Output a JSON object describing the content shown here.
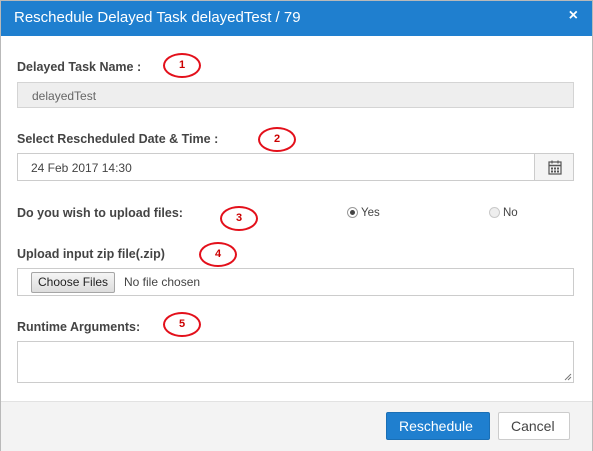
{
  "dialog": {
    "title": "Reschedule Delayed Task delayedTest / 79",
    "close_glyph": "×"
  },
  "task_name": {
    "label": "Delayed Task Name :",
    "value": "delayedTest"
  },
  "reschedule_date": {
    "label": "Select Rescheduled Date & Time :",
    "value": "24 Feb 2017 14:30",
    "button_icon": "calendar-icon"
  },
  "upload_choice": {
    "label": "Do you wish to upload files:",
    "options": [
      {
        "label": "Yes",
        "selected": true
      },
      {
        "label": "No",
        "selected": false
      }
    ]
  },
  "upload_zip": {
    "label": "Upload input zip file(.zip)",
    "button_label": "Choose Files",
    "status": "No file chosen"
  },
  "runtime_args": {
    "label": "Runtime Arguments:",
    "value": ""
  },
  "footer": {
    "primary_label": "Reschedule",
    "cancel_label": "Cancel"
  },
  "annotations": [
    "1",
    "2",
    "3",
    "4",
    "5"
  ],
  "colors": {
    "header": "#1f7fcf",
    "primary_button": "#1f7fcf",
    "annotation": "#e3101b"
  }
}
